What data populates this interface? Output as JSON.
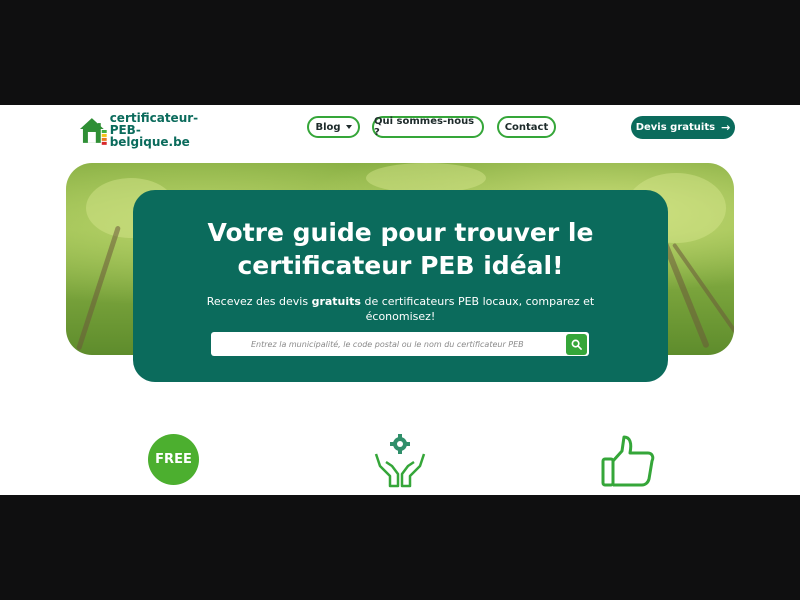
{
  "header": {
    "logo_line1": "certificateur-PEB-",
    "logo_line2": "belgique.be",
    "nav": {
      "blog": "Blog",
      "about": "Qui sommes-nous ?",
      "contact": "Contact"
    },
    "cta": "Devis gratuits"
  },
  "hero": {
    "title_line1": "Votre guide pour trouver le",
    "title_line2": "certificateur PEB idéal!",
    "subtitle_before": "Recevez des devis ",
    "subtitle_bold": "gratuits",
    "subtitle_after": " de certificateurs PEB locaux, comparez et",
    "subtitle_line2": "économisez!",
    "search_placeholder": "Entrez la municipalité, le code postal ou le nom du certificateur PEB"
  },
  "features": {
    "free_badge": "FREE"
  },
  "colors": {
    "primary": "#0b6b5c",
    "accent": "#35a639",
    "badge": "#4caf2f",
    "letterbox": "#0f0f10"
  },
  "icons": [
    "house-logo-icon",
    "chevron-down-icon",
    "arrow-right-icon",
    "search-icon",
    "hands-gear-icon",
    "thumbs-up-icon"
  ]
}
